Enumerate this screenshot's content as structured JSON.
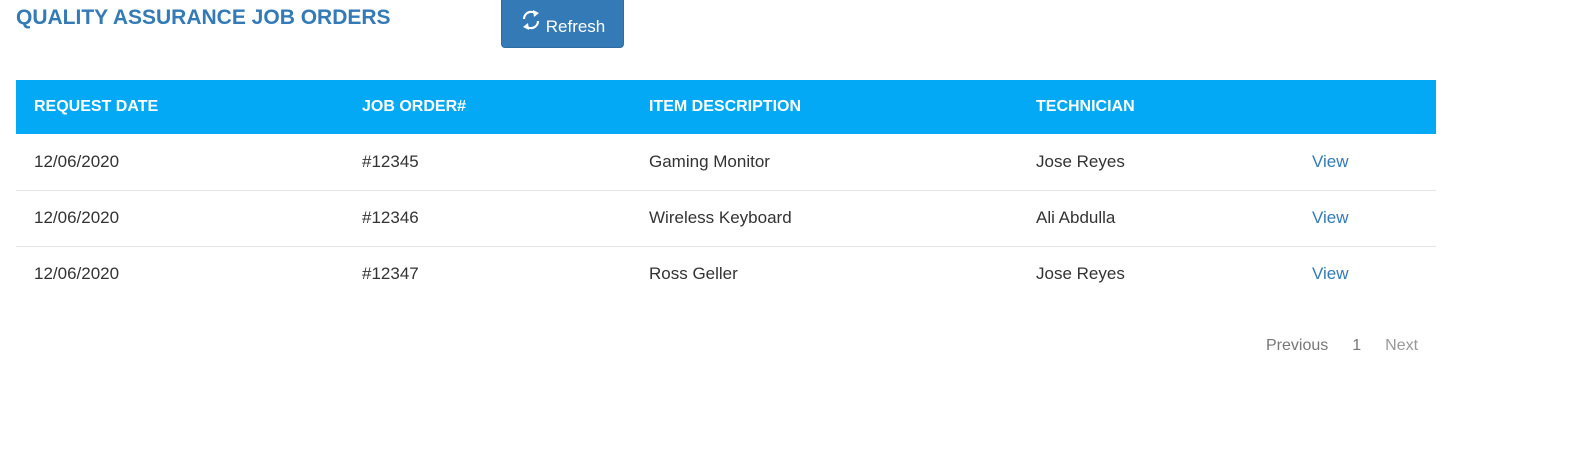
{
  "header": {
    "title": "QUALITY ASSURANCE JOB ORDERS",
    "refresh_label": "Refresh",
    "refresh_icon": "refresh-icon"
  },
  "table": {
    "columns": [
      "REQUEST DATE",
      "JOB ORDER#",
      "ITEM DESCRIPTION",
      "TECHNICIAN",
      ""
    ],
    "rows": [
      {
        "date": "12/06/2020",
        "job": "#12345",
        "item": "Gaming Monitor",
        "tech": "Jose Reyes",
        "action": "View"
      },
      {
        "date": "12/06/2020",
        "job": "#12346",
        "item": "Wireless Keyboard",
        "tech": "Ali Abdulla",
        "action": "View"
      },
      {
        "date": "12/06/2020",
        "job": "#12347",
        "item": "Ross Geller",
        "tech": "Jose Reyes",
        "action": "View"
      }
    ]
  },
  "pagination": {
    "previous": "Previous",
    "current": "1",
    "next": "Next"
  },
  "colors": {
    "accent": "#337ab7",
    "header_bg": "#03a9f4"
  }
}
